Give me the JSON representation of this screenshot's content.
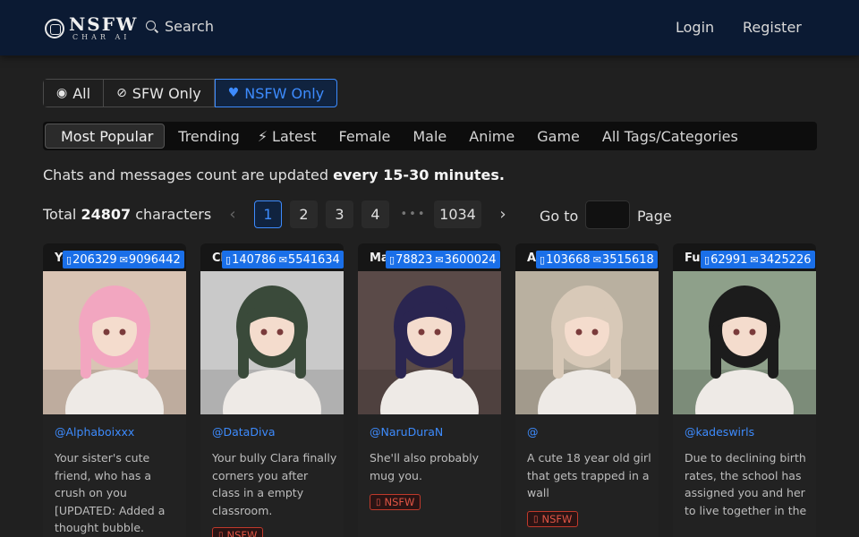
{
  "header": {
    "logo_main": "NSFW",
    "logo_sub": "CHAR AI",
    "search_label": "Search",
    "login_label": "Login",
    "register_label": "Register"
  },
  "filters": [
    {
      "label": "All",
      "icon": "eye-icon",
      "active": false
    },
    {
      "label": "SFW Only",
      "icon": "eye-slash-icon",
      "active": false
    },
    {
      "label": "NSFW Only",
      "icon": "heart-icon",
      "active": true
    }
  ],
  "tabs": [
    {
      "label": "Most Popular",
      "glyph": "",
      "active": true
    },
    {
      "label": "Trending",
      "glyph": ""
    },
    {
      "label": "Latest",
      "glyph": "⚡"
    },
    {
      "label": "Female",
      "glyph": ""
    },
    {
      "label": "Male",
      "glyph": ""
    },
    {
      "label": "Anime",
      "glyph": ""
    },
    {
      "label": "Game",
      "glyph": ""
    },
    {
      "label": "All Tags/Categories",
      "glyph": ""
    }
  ],
  "info": {
    "prefix": "Chats and messages count are updated ",
    "emphasis": "every 15-30 minutes."
  },
  "pagination": {
    "total_prefix": "Total ",
    "total_count": "24807",
    "total_suffix": " characters",
    "prev": "‹",
    "pages": [
      "1",
      "2",
      "3",
      "4"
    ],
    "dots": "•••",
    "last": "1034",
    "next": "›",
    "goto_label": "Go to",
    "goto_value": "",
    "page_label": "Page"
  },
  "cards": [
    {
      "title": "Yo",
      "chats": "206329",
      "messages": "9096442",
      "author": "@Alphaboixxx",
      "description": "Your sister's cute friend, who has a crush on you [UPDATED: Added a thought bubble.",
      "tag": "",
      "hair": "#f2a6c0",
      "bg": "#d9c4b4"
    },
    {
      "title": "Cl",
      "chats": "140786",
      "messages": "5541634",
      "author": "@DataDiva",
      "description": "Your bully Clara finally corners you after class in a empty classroom.",
      "tag": "NSFW",
      "hair": "#3a4a3a",
      "bg": "#c9c9c9"
    },
    {
      "title": "Ma",
      "chats": "78823",
      "messages": "3600024",
      "author": "@NaruDuraN",
      "description": "She'll also probably mug you.",
      "tag": "NSFW",
      "hair": "#2a2550",
      "bg": "#5a4a48"
    },
    {
      "title": "Ar",
      "chats": "103668",
      "messages": "3515618",
      "author": "@",
      "description": "A cute 18 year old girl that gets trapped in a wall",
      "tag": "NSFW",
      "hair": "#d8c9b8",
      "bg": "#b9b0a0"
    },
    {
      "title": "Fu",
      "chats": "62991",
      "messages": "3425226",
      "author": "@kadeswirls",
      "description": "Due to declining birth rates, the school has assigned you and her to live together in the",
      "tag": "",
      "hair": "#1c1c1c",
      "bg": "#8ea08a"
    }
  ]
}
